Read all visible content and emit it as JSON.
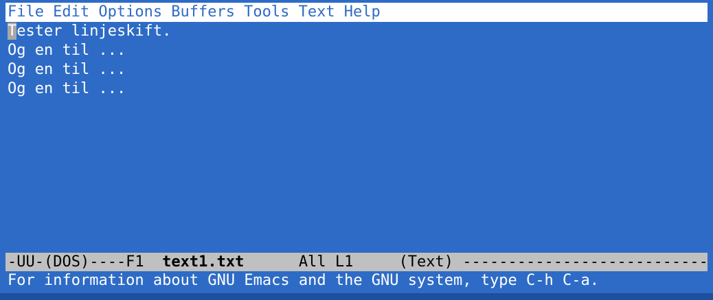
{
  "menu": {
    "items": [
      "File",
      "Edit",
      "Options",
      "Buffers",
      "Tools",
      "Text",
      "Help"
    ]
  },
  "buffer": {
    "cursor_char": "T",
    "first_line_rest": "ester linjeskift.",
    "lines": [
      "Og en til ...",
      "Og en til ...",
      "Og en til ..."
    ]
  },
  "modeline": {
    "prefix": "-UU-(DOS)----F1  ",
    "buffer_name": "text1.txt",
    "position": "      All L1     ",
    "mode": "(Text)",
    "dashes": " ------------------------------------------------"
  },
  "echo_area": {
    "message": "For information about GNU Emacs and the GNU system, type C-h C-a."
  },
  "colors": {
    "background": "#2e6bc6",
    "menubar_bg": "#ffffff",
    "modeline_bg": "#c0c0c0",
    "cursor": "#a7a7a7"
  }
}
